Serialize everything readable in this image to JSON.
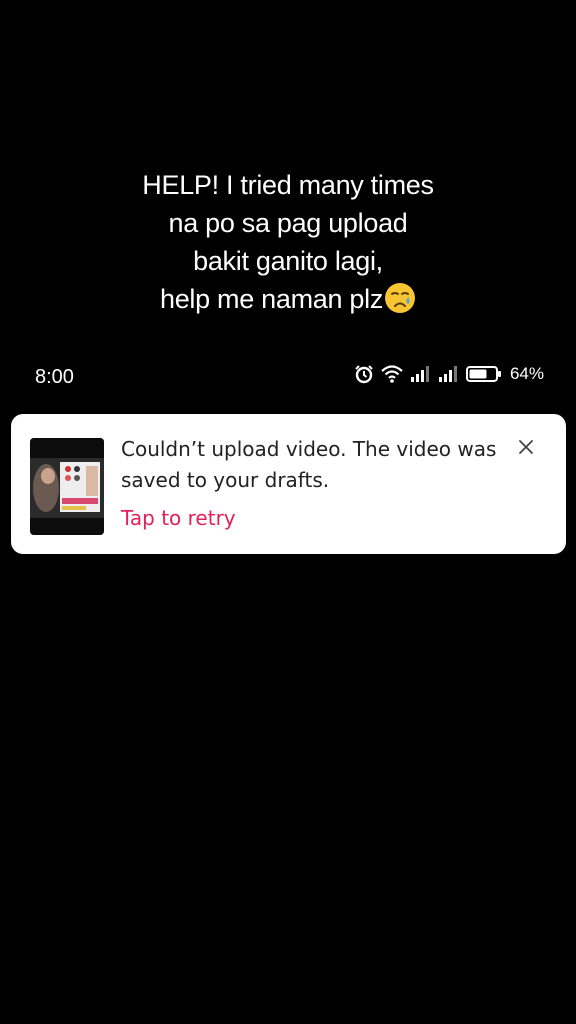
{
  "caption": {
    "lines": [
      "HELP! I tried many times",
      "na po sa pag upload",
      "bakit ganito lagi,",
      "help me naman plz"
    ],
    "emoji": "crying-face-icon"
  },
  "statusbar": {
    "time": "8:00",
    "battery_percent": "64%",
    "icons": [
      "alarm-icon",
      "wifi-icon",
      "signal-icon",
      "signal-icon",
      "battery-icon"
    ]
  },
  "notification": {
    "message": "Couldn’t upload video. The video was saved to your drafts.",
    "action": "Tap to retry",
    "action_color": "#e2205a",
    "close_icon": "close-icon"
  }
}
